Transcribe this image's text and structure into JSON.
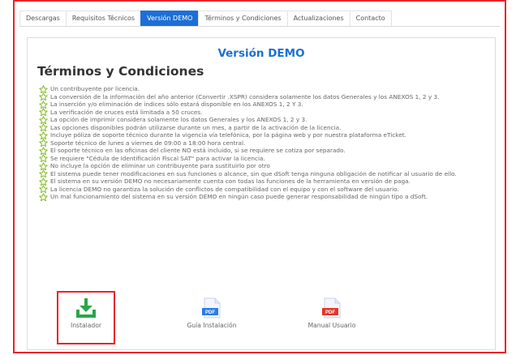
{
  "tabs": [
    {
      "label": "Descargas",
      "active": false
    },
    {
      "label": "Requisitos Técnicos",
      "active": false
    },
    {
      "label": "Versión DEMO",
      "active": true
    },
    {
      "label": "Términos y Condiciones",
      "active": false
    },
    {
      "label": "Actualizaciones",
      "active": false
    },
    {
      "label": "Contacto",
      "active": false
    }
  ],
  "panel": {
    "title": "Versión DEMO",
    "subtitle": "Términos y Condiciones"
  },
  "terms": [
    "Un contribuyente por licencia.",
    "La conversión de la información del año anterior (Convertir .XSPR) considera solamente los datos Generales y los ANEXOS 1, 2 y 3.",
    "La inserción y/o eliminación de índices sólo estará disponible en los ANEXOS 1, 2 Y 3.",
    "La verificación de cruces está limitada a 50 cruces.",
    "La opción de imprimir considera solamente los datos Generales y los ANEXOS 1, 2 y 3.",
    "Las opciones disponibles podrán utilizarse durante un mes, a partir de la activación de la licencia.",
    "Incluye póliza de soporte técnico durante la vigencia vía telefónica, por la página web y por nuestra plataforma eTicket.",
    "Soporte técnico de lunes a viernes de 09:00 a 18:00 hora central.",
    "El soporte técnico en las oficinas del cliente NO está incluido, si se requiere se cotiza por separado.",
    "Se requiere \"Cédula de Identificación Fiscal SAT\" para activar la licencia.",
    "No incluye la opción de eliminar un contribuyente para sustituirlo por otro",
    "El sistema puede tener modificaciones en sus funciones o alcance, sin que dSoft tenga ninguna obligación de notificar al usuario de ello.",
    "El sistema en su versión DEMO no necesariamente cuenta con todas las funciones de la herramienta en versión de paga.",
    "La licencia DEMO no garantiza la solución de conflictos de compatibilidad con el equipo y con el software del usuario.",
    "Un mal funcionamiento del sistema en su versión DEMO en ningún caso puede generar responsabilidad de ningún tipo a dSoft."
  ],
  "downloads": {
    "installer": {
      "label": "Instalador",
      "icon": "download-icon"
    },
    "guide": {
      "label": "Guía Instalación",
      "icon": "pdf-icon",
      "badge": "PDF"
    },
    "manual": {
      "label": "Manual Usuario",
      "icon": "pdf-icon",
      "badge": "PDF"
    }
  },
  "colors": {
    "accent": "#1d6fd6",
    "highlight_border": "#e8242a",
    "star": "#7cb518",
    "download_green": "#2aa64a",
    "pdf_blue": "#2b7de9",
    "pdf_red": "#e5352b"
  }
}
